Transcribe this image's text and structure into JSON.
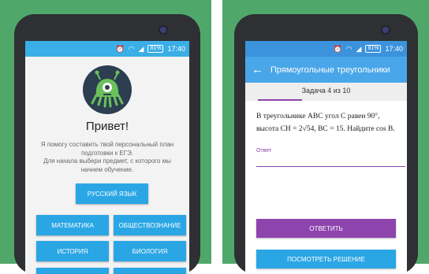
{
  "colors": {
    "background": "#4fa86a",
    "accent_blue": "#2ba6e5",
    "accent_purple": "#8e44ad",
    "bezel": "#2e3033"
  },
  "left_phone": {
    "status": {
      "battery": "81%",
      "time": "17:40",
      "icons": [
        "alarm-icon",
        "wifi-icon",
        "signal-icon",
        "battery-icon"
      ]
    },
    "title": "Привет!",
    "text_1": "Я помогу составить твой персональный план подготовки к ЕГЭ.",
    "text_2": "Для начала выбери предмет, с которого мы начнем обучение.",
    "subjects": {
      "russian": "Русский язык",
      "math": "Математика",
      "social": "Обществознание",
      "history": "История",
      "biology": "Биология"
    }
  },
  "right_phone": {
    "status": {
      "battery": "81%",
      "time": "17:40",
      "icons": [
        "alarm-icon",
        "wifi-icon",
        "signal-icon",
        "battery-icon"
      ]
    },
    "title": "Прямоугольные треугольники",
    "task_counter": "Задача 4 из 10",
    "problem_line_1": "В треугольнике ABC угол C равен 90°,",
    "problem_line_2": "высота CH = 2√54, BC = 15. Найдите cos B.",
    "answer_label": "Ответ",
    "answer_value": "",
    "submit_label": "Ответить",
    "solution_label": "Посмотреть решение"
  }
}
